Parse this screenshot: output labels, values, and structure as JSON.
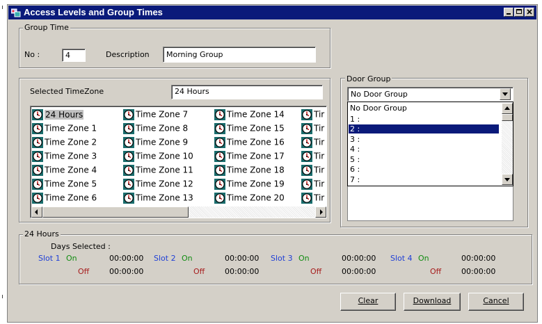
{
  "window": {
    "title": "Access Levels and Group Times"
  },
  "group_time": {
    "legend": "Group Time",
    "no_label": "No :",
    "no_value": "4",
    "description_label": "Description",
    "description_value": "Morning Group"
  },
  "timezone_panel": {
    "selected_label": "Selected TimeZone",
    "selected_value": "24 Hours",
    "columns": [
      [
        "24 Hours",
        "Time Zone 1",
        "Time Zone 2",
        "Time Zone 3",
        "Time Zone 4",
        "Time Zone 5",
        "Time Zone 6"
      ],
      [
        "Time Zone 7",
        "Time Zone 8",
        "Time Zone 9",
        "Time Zone 10",
        "Time Zone 11",
        "Time Zone 12",
        "Time Zone 13"
      ],
      [
        "Time Zone 14",
        "Time Zone 15",
        "Time Zone 16",
        "Time Zone 17",
        "Time Zone 18",
        "Time Zone 19",
        "Time Zone 20"
      ],
      [
        "Tir",
        "Tir",
        "Tir",
        "Tir",
        "Tir",
        "Tir",
        "Tir"
      ]
    ]
  },
  "door_group": {
    "legend": "Door Group",
    "selected": "No Door Group",
    "options": [
      "No Door Group",
      "1 :",
      "2 :",
      "3 :",
      "4 :",
      "5 :",
      "6 :",
      "7 :"
    ],
    "highlighted": "2 :"
  },
  "schedule": {
    "legend": "24 Hours",
    "days_selected_label": "Days Selected :",
    "slots": [
      {
        "name": "Slot 1",
        "on_label": "On",
        "off_label": "Off",
        "on_time": "00:00:00",
        "off_time": "00:00:00"
      },
      {
        "name": "Slot 2",
        "on_label": "On",
        "off_label": "Off",
        "on_time": "00:00:00",
        "off_time": "00:00:00"
      },
      {
        "name": "Slot 3",
        "on_label": "On",
        "off_label": "Off",
        "on_time": "00:00:00",
        "off_time": "00:00:00"
      },
      {
        "name": "Slot 4",
        "on_label": "On",
        "off_label": "Off",
        "on_time": "00:00:00",
        "off_time": "00:00:00"
      }
    ]
  },
  "buttons": {
    "clear": "Clear",
    "download": "Download",
    "cancel": "Cancel"
  },
  "colors": {
    "titlebar": "#0a1a7a",
    "dialog_face": "#d4d0c8",
    "slot_label": "#1f3fd6",
    "on_label": "#118c11",
    "off_label": "#a61b1b"
  },
  "icons": {
    "app": "access-levels-icon",
    "timezone_item": "clock-icon"
  }
}
